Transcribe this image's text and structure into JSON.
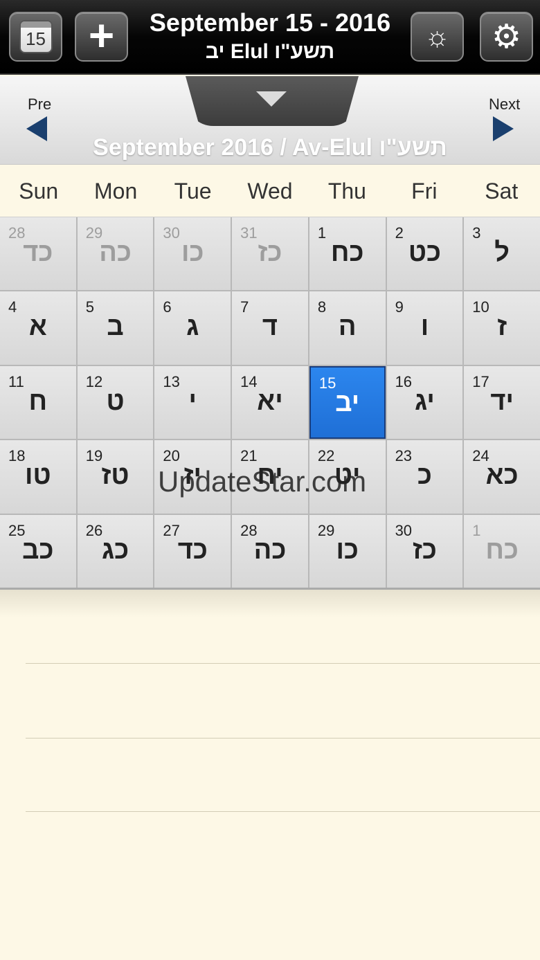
{
  "header": {
    "calendar_button_day": "15",
    "title": "September 15 - 2016",
    "subtitle": "יב Elul תשע\"ו",
    "icons": {
      "calendar": "calendar-icon",
      "add": "plus-icon",
      "brightness": "sun-icon",
      "settings": "gear-icon"
    }
  },
  "nav": {
    "pre_label": "Pre",
    "next_label": "Next",
    "month_title": "September 2016  /  Av-Elul תשע\"ו"
  },
  "weekdays": [
    "Sun",
    "Mon",
    "Tue",
    "Wed",
    "Thu",
    "Fri",
    "Sat"
  ],
  "calendar": {
    "selected_color": "#1f6fd6",
    "weeks": [
      [
        {
          "g": "28",
          "h": "כד",
          "muted": true
        },
        {
          "g": "29",
          "h": "כה",
          "muted": true
        },
        {
          "g": "30",
          "h": "כו",
          "muted": true
        },
        {
          "g": "31",
          "h": "כז",
          "muted": true
        },
        {
          "g": "1",
          "h": "כח"
        },
        {
          "g": "2",
          "h": "כט"
        },
        {
          "g": "3",
          "h": "ל"
        }
      ],
      [
        {
          "g": "4",
          "h": "א"
        },
        {
          "g": "5",
          "h": "ב"
        },
        {
          "g": "6",
          "h": "ג"
        },
        {
          "g": "7",
          "h": "ד"
        },
        {
          "g": "8",
          "h": "ה"
        },
        {
          "g": "9",
          "h": "ו"
        },
        {
          "g": "10",
          "h": "ז"
        }
      ],
      [
        {
          "g": "11",
          "h": "ח"
        },
        {
          "g": "12",
          "h": "ט"
        },
        {
          "g": "13",
          "h": "י"
        },
        {
          "g": "14",
          "h": "יא"
        },
        {
          "g": "15",
          "h": "יב",
          "selected": true
        },
        {
          "g": "16",
          "h": "יג"
        },
        {
          "g": "17",
          "h": "יד"
        }
      ],
      [
        {
          "g": "18",
          "h": "טו"
        },
        {
          "g": "19",
          "h": "טז"
        },
        {
          "g": "20",
          "h": "יז"
        },
        {
          "g": "21",
          "h": "יח"
        },
        {
          "g": "22",
          "h": "יט"
        },
        {
          "g": "23",
          "h": "כ"
        },
        {
          "g": "24",
          "h": "כא"
        }
      ],
      [
        {
          "g": "25",
          "h": "כב"
        },
        {
          "g": "26",
          "h": "כג"
        },
        {
          "g": "27",
          "h": "כד"
        },
        {
          "g": "28",
          "h": "כה"
        },
        {
          "g": "29",
          "h": "כו"
        },
        {
          "g": "30",
          "h": "כז"
        },
        {
          "g": "1",
          "h": "כח",
          "muted": true
        }
      ]
    ]
  },
  "watermark": "UpdateStar.com"
}
